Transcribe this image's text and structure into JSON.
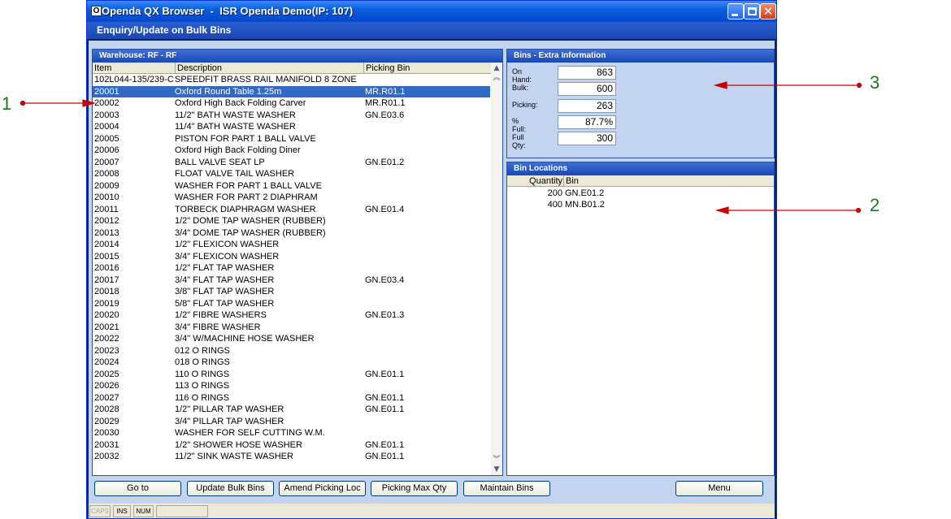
{
  "window": {
    "title": "Openda QX Browser  -  ISR Openda Demo(IP: 107)",
    "subtitle": "Enquiry/Update on Bulk Bins",
    "icon_glyph": "O"
  },
  "items_panel": {
    "header": "Warehouse: RF - RF",
    "columns": [
      "Item",
      "Description",
      "Picking Bin"
    ],
    "rows": [
      {
        "item": "102L044-135/239-C",
        "desc": "SPEEDFIT BRASS RAIL MANIFOLD 8 ZONE",
        "bin": ""
      },
      {
        "item": "20001",
        "desc": "Oxford Round Table 1.25m",
        "bin": "MR.R01.1",
        "selected": true
      },
      {
        "item": "20002",
        "desc": "Oxford High Back Folding Carver",
        "bin": "MR.R01.1"
      },
      {
        "item": "20003",
        "desc": "11/2\" BATH WASTE WASHER",
        "bin": "GN.E03.6"
      },
      {
        "item": "20004",
        "desc": "11/4\" BATH WASTE WASHER",
        "bin": ""
      },
      {
        "item": "20005",
        "desc": "PISTON FOR PART 1 BALL VALVE",
        "bin": ""
      },
      {
        "item": "20006",
        "desc": "Oxford High Back Folding Diner",
        "bin": ""
      },
      {
        "item": "20007",
        "desc": "BALL VALVE SEAT LP",
        "bin": "GN.E01.2"
      },
      {
        "item": "20008",
        "desc": "FLOAT VALVE TAIL WASHER",
        "bin": ""
      },
      {
        "item": "20009",
        "desc": "WASHER FOR PART 1 BALL VALVE",
        "bin": ""
      },
      {
        "item": "20010",
        "desc": "WASHER FOR PART 2 DIAPHRAM",
        "bin": ""
      },
      {
        "item": "20011",
        "desc": "TORBECK DIAPHRAGM WASHER",
        "bin": "GN.E01.4"
      },
      {
        "item": "20012",
        "desc": "1/2\" DOME TAP WASHER (RUBBER)",
        "bin": ""
      },
      {
        "item": "20013",
        "desc": "3/4\" DOME TAP WASHER (RUBBER)",
        "bin": ""
      },
      {
        "item": "20014",
        "desc": "1/2\" FLEXICON WASHER",
        "bin": ""
      },
      {
        "item": "20015",
        "desc": "3/4\" FLEXICON WASHER",
        "bin": ""
      },
      {
        "item": "20016",
        "desc": "1/2\" FLAT TAP WASHER",
        "bin": ""
      },
      {
        "item": "20017",
        "desc": "3/4\" FLAT TAP WASHER",
        "bin": "GN.E03.4"
      },
      {
        "item": "20018",
        "desc": "3/8\" FLAT TAP WASHER",
        "bin": ""
      },
      {
        "item": "20019",
        "desc": "5/8\" FLAT TAP WASHER",
        "bin": ""
      },
      {
        "item": "20020",
        "desc": "1/2\" FIBRE WASHERS",
        "bin": "GN.E01.3"
      },
      {
        "item": "20021",
        "desc": "3/4\" FIBRE WASHER",
        "bin": ""
      },
      {
        "item": "20022",
        "desc": "3/4\" W/MACHINE HOSE WASHER",
        "bin": ""
      },
      {
        "item": "20023",
        "desc": "012  O RINGS",
        "bin": ""
      },
      {
        "item": "20024",
        "desc": "018  O RINGS",
        "bin": ""
      },
      {
        "item": "20025",
        "desc": "110  O RINGS",
        "bin": "GN.E01.1"
      },
      {
        "item": "20026",
        "desc": "113  O RINGS",
        "bin": ""
      },
      {
        "item": "20027",
        "desc": "116  O RINGS",
        "bin": "GN.E01.1"
      },
      {
        "item": "20028",
        "desc": "1/2\" PILLAR TAP WASHER",
        "bin": "GN.E01.1"
      },
      {
        "item": "20029",
        "desc": "3/4\" PILLAR TAP WASHER",
        "bin": ""
      },
      {
        "item": "20030",
        "desc": "WASHER FOR SELF CUTTING W.M.",
        "bin": ""
      },
      {
        "item": "20031",
        "desc": "1/2\" SHOWER HOSE WASHER",
        "bin": "GN.E01.1"
      },
      {
        "item": "20032",
        "desc": "11/2\" SINK WASTE WASHER",
        "bin": "GN.E01.1"
      }
    ]
  },
  "extra_info": {
    "header": "Bins - Extra Information",
    "fields": [
      {
        "label": "On Hand:",
        "value": "863"
      },
      {
        "label": "Bulk:",
        "value": "600"
      },
      {
        "label": "Picking:",
        "value": "263"
      },
      {
        "label": "% Full:",
        "value": "87.7%"
      },
      {
        "label": "Full Qty:",
        "value": "300"
      }
    ]
  },
  "bin_locations": {
    "header": "Bin Locations",
    "columns": [
      "Quantity",
      "Bin"
    ],
    "rows": [
      {
        "qty": "200",
        "bin": "GN.E01.2"
      },
      {
        "qty": "400",
        "bin": "MN.B01.2"
      }
    ]
  },
  "buttons": {
    "goto": "Go to",
    "update_bulk": "Update Bulk Bins",
    "amend_picking": "Amend Picking Loc",
    "picking_max": "Picking Max Qty",
    "maintain": "Maintain Bins",
    "menu": "Menu"
  },
  "status_bar": {
    "caps": "CAPS",
    "ins": "INS",
    "num": "NUM"
  },
  "annotations": {
    "one": "1",
    "two": "2",
    "three": "3",
    "color": "#cc0000"
  }
}
